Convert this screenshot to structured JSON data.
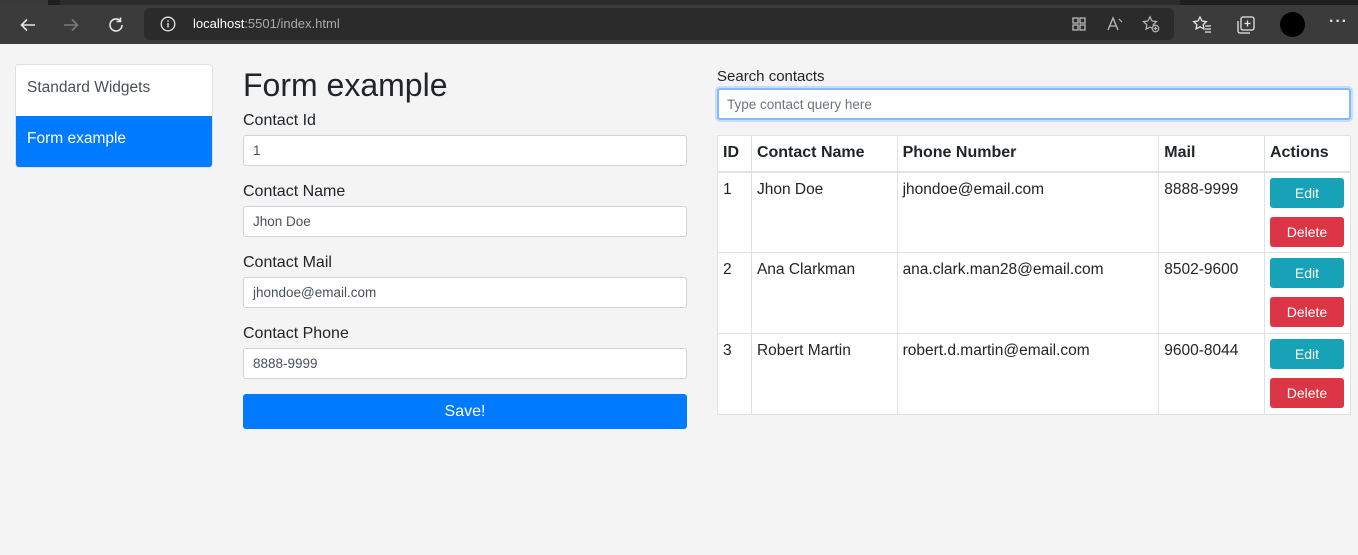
{
  "browser": {
    "url_host": "localhost",
    "url_rest": ":5501/index.html"
  },
  "sidebar": {
    "items": [
      {
        "label": "Standard Widgets"
      },
      {
        "label": "Form example"
      }
    ]
  },
  "form": {
    "title": "Form example",
    "fields": [
      {
        "label": "Contact Id",
        "value": "1"
      },
      {
        "label": "Contact Name",
        "value": "Jhon Doe"
      },
      {
        "label": "Contact Mail",
        "value": "jhondoe@email.com"
      },
      {
        "label": "Contact Phone",
        "value": "8888-9999"
      }
    ],
    "save_label": "Save!"
  },
  "search": {
    "label": "Search contacts",
    "placeholder": "Type contact query here"
  },
  "table": {
    "headers": [
      "ID",
      "Contact Name",
      "Phone Number",
      "Mail",
      "Actions"
    ],
    "rows": [
      {
        "id": "1",
        "name": "Jhon Doe",
        "phone": "jhondoe@email.com",
        "mail": "8888-9999"
      },
      {
        "id": "2",
        "name": "Ana Clarkman",
        "phone": "ana.clark.man28@email.com",
        "mail": "8502-9600"
      },
      {
        "id": "3",
        "name": "Robert Martin",
        "phone": "robert.d.martin@email.com",
        "mail": "9600-8044"
      }
    ],
    "edit_label": "Edit",
    "delete_label": "Delete"
  },
  "colors": {
    "primary": "#007bff",
    "info": "#17a2b8",
    "danger": "#dc3545"
  }
}
